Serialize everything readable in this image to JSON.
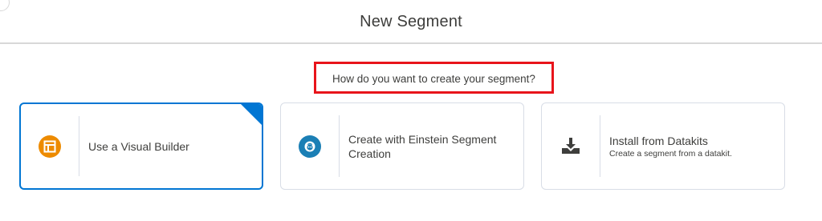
{
  "modal": {
    "title": "New Segment",
    "question": "How do you want to create your segment?"
  },
  "options": [
    {
      "label": "Use a Visual Builder",
      "subtitle": "",
      "icon": "layout-icon",
      "icon_color": "#ed8b00",
      "selected": true
    },
    {
      "label": "Create with Einstein Segment Creation",
      "subtitle": "",
      "icon": "einstein-icon",
      "icon_color": "#1b7fb5",
      "selected": false
    },
    {
      "label": "Install from Datakits",
      "subtitle": "Create a segment from a datakit.",
      "icon": "download-icon",
      "icon_color": "#3e3e3c",
      "selected": false
    }
  ],
  "colors": {
    "selected_border": "#0176d3",
    "highlight_box": "#e8141b"
  }
}
